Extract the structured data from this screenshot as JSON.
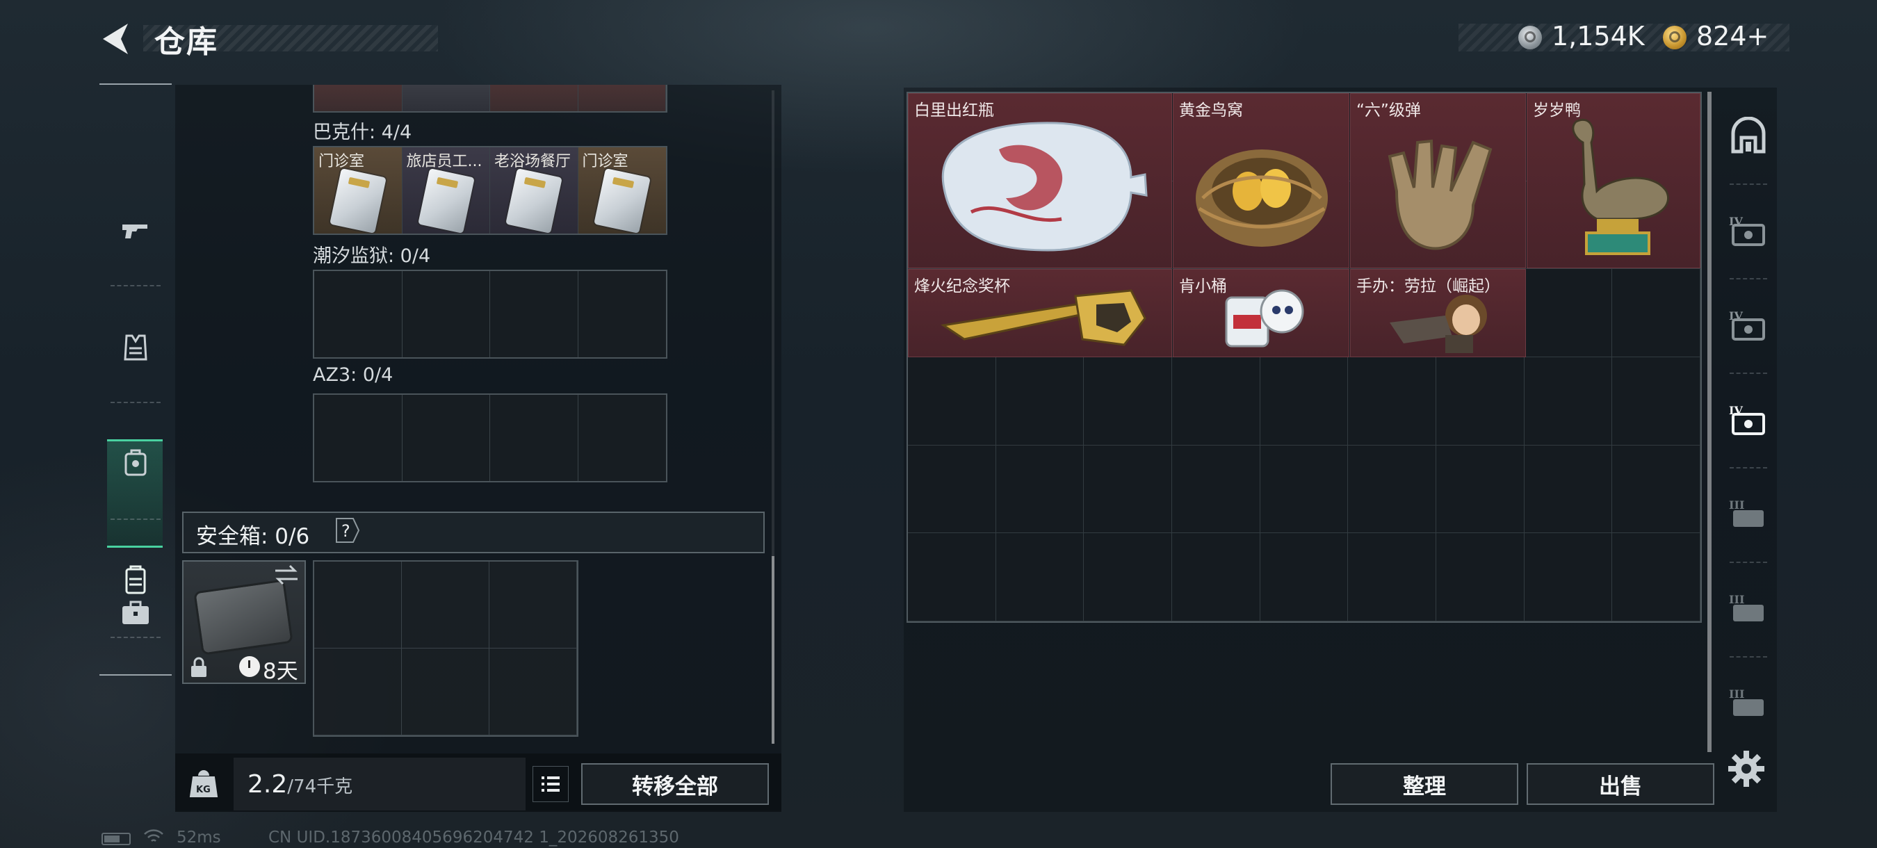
{
  "header": {
    "title": "仓库",
    "currency_silver": "1,154K",
    "currency_gold": "824+",
    "icons": {
      "back": "back-arrow-icon",
      "silver": "silver-coin-icon",
      "gold": "gold-coin-icon"
    }
  },
  "left_nav": {
    "items": [
      {
        "icon": "gun-icon"
      },
      {
        "icon": "vest-icon"
      },
      {
        "icon": "helmet-bag-icon"
      },
      {
        "icon": "backpack-icon",
        "active": true
      },
      {
        "icon": "briefcase-icon"
      }
    ],
    "active_color": "#49d1a0"
  },
  "key_groups": [
    {
      "label": "巴克什: 4/4",
      "slots": [
        {
          "name": "门诊室",
          "style": "gold"
        },
        {
          "name": "旅店员工...",
          "style": "purple"
        },
        {
          "name": "老浴场餐厅",
          "style": "purple"
        },
        {
          "name": "门诊室",
          "style": "gold"
        }
      ]
    },
    {
      "label": "潮汐监狱: 0/4",
      "slots": []
    },
    {
      "label": "AZ3: 0/4",
      "slots": []
    }
  ],
  "safe_box": {
    "label": "安全箱: 0/6",
    "help_icon": "question-icon",
    "days_left": "8天"
  },
  "bottom": {
    "weight_current": "2.2",
    "weight_max": "/74千克",
    "transfer_all": "转移全部"
  },
  "status": {
    "ping": "52ms",
    "uid": "CN UID.18736008405696204742 1_202608261350"
  },
  "stash_items": [
    {
      "name": "白里出红瓶",
      "icon": "porcelain-vase-icon"
    },
    {
      "name": "黄金鸟窝",
      "icon": "golden-nest-icon"
    },
    {
      "name": "“六”级弹",
      "icon": "hand-sculpture-icon"
    },
    {
      "name": "岁岁鸭",
      "icon": "duck-statue-icon"
    },
    {
      "name": "烽火纪念奖杯",
      "icon": "trophy-icon"
    },
    {
      "name": "肯小桶",
      "icon": "figurine-icon"
    },
    {
      "name": "手办：劳拉（崛起）",
      "icon": "lara-figure-icon"
    }
  ],
  "stash_actions": {
    "sort": "整理",
    "sell": "出售"
  },
  "right_nav": {
    "items": [
      "shelter-icon",
      "tier-iv-case-icon",
      "tier-iv-case-icon",
      "tier-iv-case-active-icon",
      "tier-iii-case-icon",
      "tier-iii-case-icon",
      "tier-iii-case-icon"
    ],
    "settings_icon": "gear-icon"
  },
  "colors": {
    "item_bg": "#5a2a31",
    "accent_green": "#49d1a0"
  }
}
